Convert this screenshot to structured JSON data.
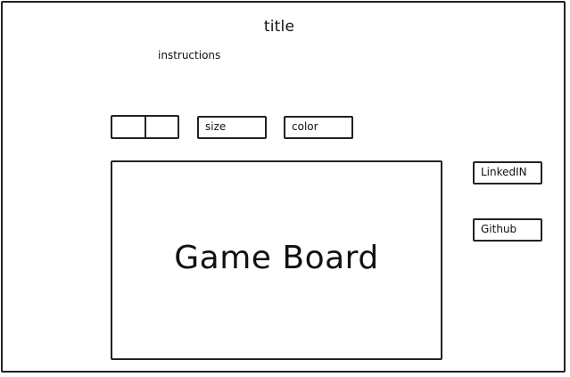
{
  "header": {
    "title": "title",
    "instructions": "instructions"
  },
  "controls": {
    "size_label": "size",
    "color_label": "color"
  },
  "board": {
    "label": "Game Board"
  },
  "links": {
    "linkedin_label": "LinkedIN",
    "github_label": "Github"
  }
}
